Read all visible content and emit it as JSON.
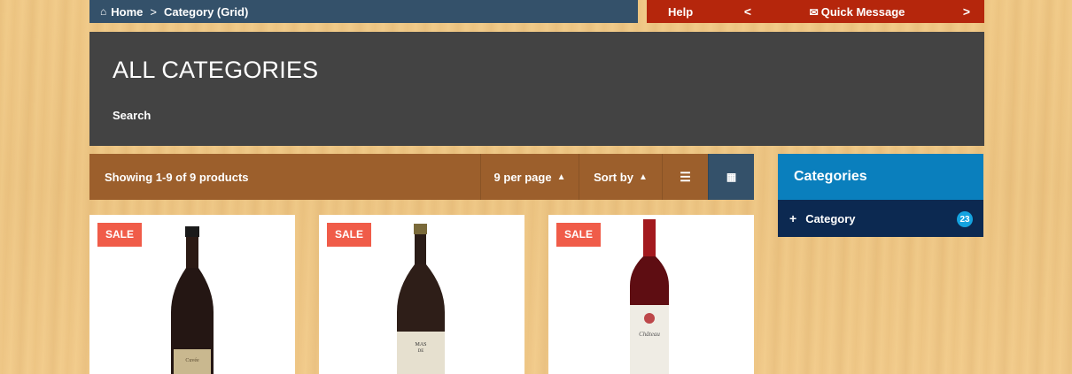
{
  "breadcrumb": {
    "home": "Home",
    "separator": ">",
    "current": "Category (Grid)"
  },
  "toolbar": {
    "help": "Help",
    "prev": "<",
    "quick_message": "Quick Message",
    "next": ">"
  },
  "hero": {
    "title": "ALL CATEGORIES",
    "search": "Search"
  },
  "listing": {
    "showing": "Showing 1-9 of 9 products",
    "per_page": "9 per page",
    "sort_by": "Sort by",
    "view_list_icon": "list-icon",
    "view_grid_icon": "grid-icon"
  },
  "sidebar": {
    "title": "Categories",
    "items": [
      {
        "label": "Category",
        "count": "23"
      }
    ]
  },
  "products": [
    {
      "badge": "SALE"
    },
    {
      "badge": "SALE"
    },
    {
      "badge": "SALE"
    }
  ],
  "colors": {
    "nav": "#34516a",
    "accent_red": "#b5260c",
    "hero": "#434343",
    "listbar": "#9c5f2c",
    "sidebar_head": "#0a7fbd",
    "sidebar_row": "#0c2951",
    "sale": "#f05c49"
  }
}
